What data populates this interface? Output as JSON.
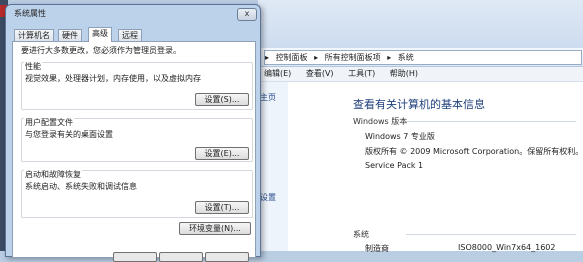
{
  "explorer": {
    "breadcrumb": [
      "控制面板",
      "所有控制面板项",
      "系统"
    ],
    "menu": [
      "编辑(E)",
      "查看(V)",
      "工具(T)",
      "帮助(H)"
    ],
    "nav_items": [
      "主页",
      "设置"
    ],
    "heading": "查看有关计算机的基本信息",
    "windows_edition_label": "Windows 版本",
    "windows_edition": "Windows 7 专业版",
    "copyright": "版权所有 © 2009 Microsoft Corporation。保留所有权利。",
    "service_pack": "Service Pack 1",
    "system_label": "系统",
    "model_label": "制造商",
    "model_value": "ISO8000_Win7x64_1602"
  },
  "dialog": {
    "title": "系统属性",
    "close_label": "x",
    "tabs": [
      "计算机名",
      "硬件",
      "高级",
      "远程"
    ],
    "admin_note": "要进行大多数更改，您必须作为管理员登录。",
    "performance": {
      "title": "性能",
      "desc": "视觉效果，处理器计划，内存使用，以及虚拟内存",
      "button": "设置(S)..."
    },
    "user_profiles": {
      "title": "用户配置文件",
      "desc": "与您登录有关的桌面设置",
      "button": "设置(E)..."
    },
    "startup": {
      "title": "启动和故障恢复",
      "desc": "系统启动、系统失败和调试信息",
      "button": "设置(T)..."
    },
    "env_button": "环境变量(N)..."
  }
}
